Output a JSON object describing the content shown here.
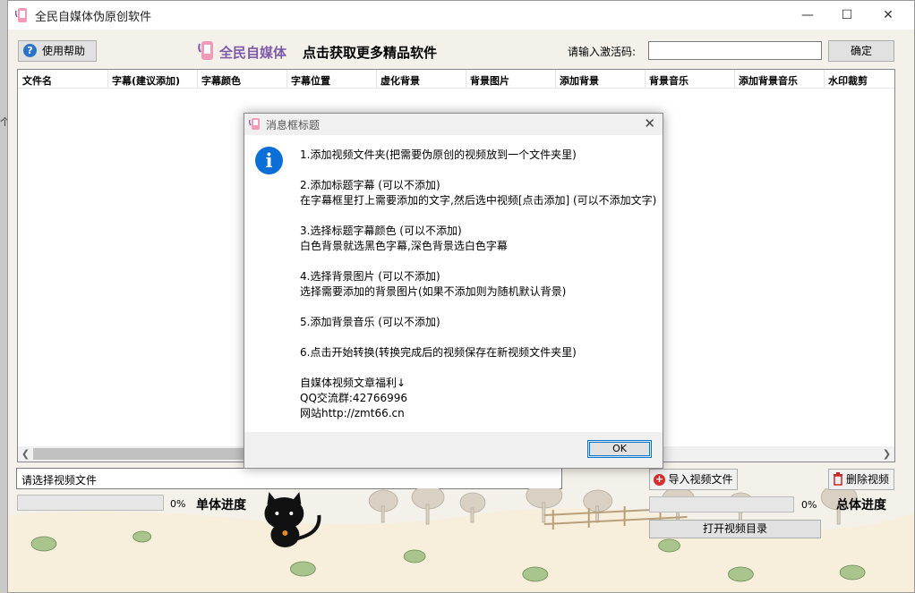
{
  "window": {
    "title": "全民自媒体伪原创软件"
  },
  "toolbar": {
    "help_label": "使用帮助",
    "brand": "全民自媒体",
    "promo": "点击获取更多精品软件",
    "activation_label": "请输入激活码:",
    "activation_value": "",
    "confirm_label": "确定"
  },
  "table": {
    "columns": [
      "文件名",
      "字幕(建议添加)",
      "字幕颜色",
      "字幕位置",
      "虚化背景",
      "背景图片",
      "添加背景",
      "背景音乐",
      "添加背景音乐",
      "水印裁剪"
    ]
  },
  "file_input": {
    "value": "请选择视频文件"
  },
  "progress": {
    "single_label": "单体进度",
    "single_percent": "0%",
    "single_value": 0,
    "total_label": "总体进度",
    "total_percent": "0%",
    "total_value": 0
  },
  "buttons": {
    "import": "导入视频文件",
    "delete": "删除视频",
    "open_dir": "打开视频目录"
  },
  "dialog": {
    "title": "消息框标题",
    "lines": [
      "1.添加视频文件夹(把需要伪原创的视频放到一个文件夹里)",
      "",
      "2.添加标题字幕  (可以不添加)",
      "在字幕框里打上需要添加的文字,然后选中视频[点击添加] (可以不添加文字)",
      "",
      "3.选择标题字幕颜色  (可以不添加)",
      "白色背景就选黑色字幕,深色背景选白色字幕",
      "",
      "4.选择背景图片  (可以不添加)",
      "选择需要添加的背景图片(如果不添加则为随机默认背景)",
      "",
      "5.添加背景音乐  (可以不添加)",
      "",
      "6.点击开始转换(转换完成后的视频保存在新视频文件夹里)",
      "",
      "自媒体视频文章福利↓",
      "QQ交流群:42766996",
      "网站http://zmt66.cn"
    ],
    "ok_label": "OK"
  },
  "colors": {
    "brand": "#7f5aa8",
    "info": "#0b6fd8",
    "accent": "#0078d7"
  }
}
